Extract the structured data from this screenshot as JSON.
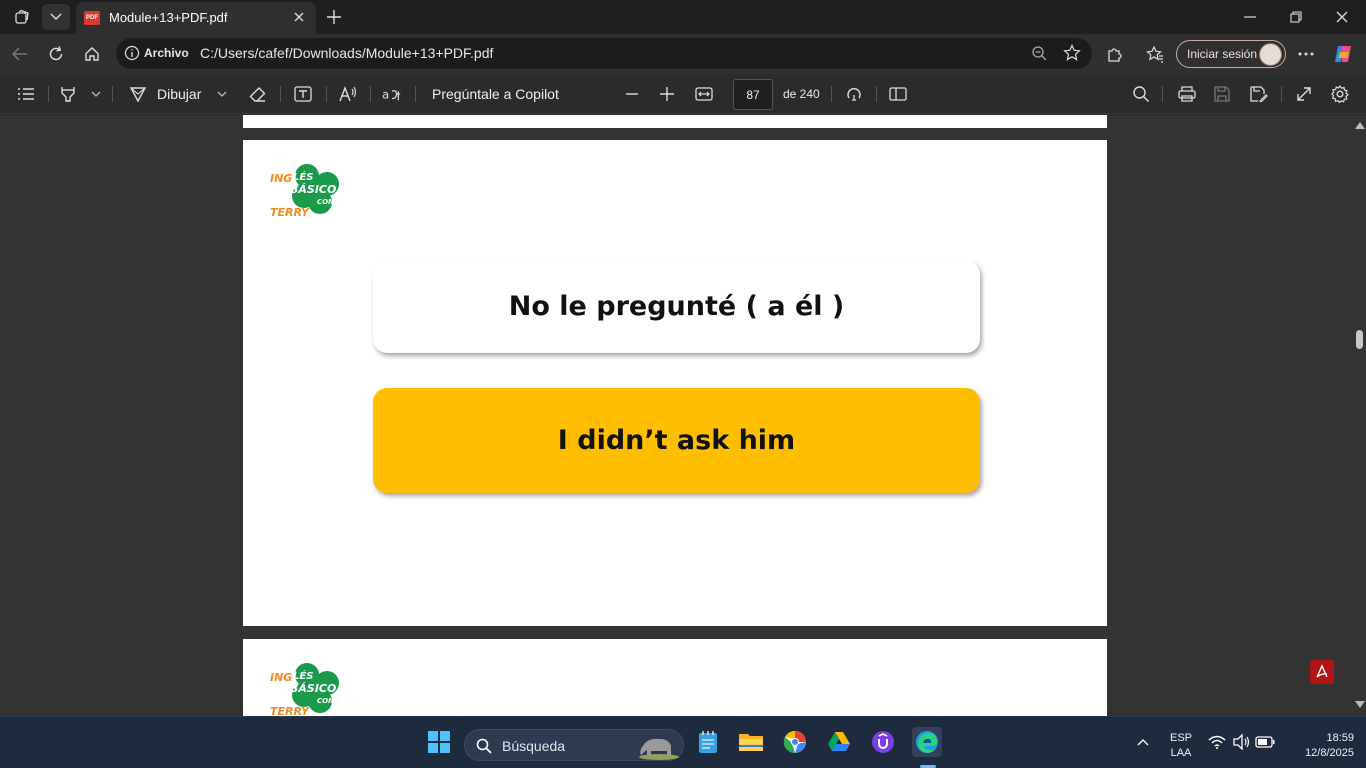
{
  "browser": {
    "tab_title": "Module+13+PDF.pdf",
    "pdf_badge": "PDF",
    "address_scheme": "Archivo",
    "address_url": "C:/Users/cafef/Downloads/Module+13+PDF.pdf",
    "signin_label": "Iniciar sesión"
  },
  "pdf_toolbar": {
    "draw_label": "Dibujar",
    "copilot_label": "Pregúntale a Copilot",
    "current_page": "87",
    "total_pages": "de 240"
  },
  "pages": [
    {
      "logo_lines": [
        "INGLÉS",
        "BÁSICO",
        "CON",
        "TERRY"
      ],
      "question": "No le pregunté ( a él )",
      "answer": "I didn’t ask him"
    }
  ],
  "taskbar": {
    "search_label": "Búsqueda",
    "lang_top": "ESP",
    "lang_bottom": "LAA",
    "time": "18:59",
    "date": "12/8/2025"
  },
  "colors": {
    "answer_card": "#ffbf00",
    "logo_green": "#1a9a4a",
    "logo_orange": "#f08a1e"
  }
}
